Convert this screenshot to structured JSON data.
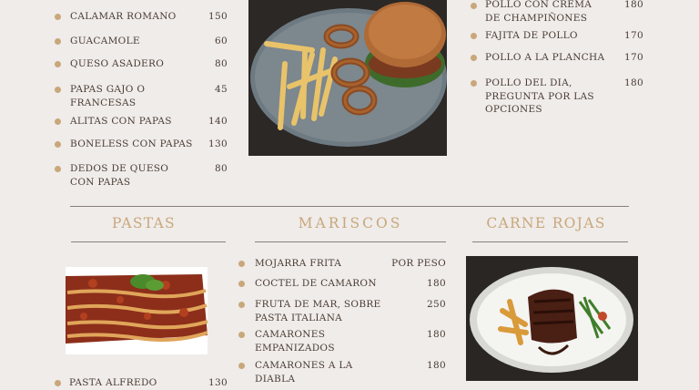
{
  "sections": {
    "pastas": "PASTAS",
    "mariscos": "MARISCOS",
    "carnes": "CARNE ROJAS"
  },
  "left_items": [
    {
      "name": "CALAMAR ROMANO",
      "price": "150"
    },
    {
      "name": "GUACAMOLE",
      "price": "60"
    },
    {
      "name": "QUESO ASADERO",
      "price": "80"
    },
    {
      "name": "PAPAS GAJO O FRANCESAS",
      "price": "45"
    },
    {
      "name": "ALITAS CON PAPAS",
      "price": "140"
    },
    {
      "name": "BONELESS CON PAPAS",
      "price": "130"
    },
    {
      "name": "DEDOS DE QUESO CON PAPAS",
      "price": "80"
    }
  ],
  "right_items": [
    {
      "name": "POLLO CON CREMA DE CHAMPIÑONES",
      "price": "180"
    },
    {
      "name": "FAJITA DE POLLO",
      "price": "170"
    },
    {
      "name": "POLLO A LA PLANCHA",
      "price": "170"
    },
    {
      "name": "POLLO DEL DIA, PREGUNTA POR LAS OPCIONES",
      "price": "180"
    }
  ],
  "mariscos_items": [
    {
      "name": "MOJARRA FRITA",
      "price": "POR PESO"
    },
    {
      "name": "COCTEL DE CAMARON",
      "price": "180"
    },
    {
      "name": "FRUTA DE MAR, SOBRE PASTA ITALIANA",
      "price": "250"
    },
    {
      "name": "CAMARONES EMPANIZADOS",
      "price": "180"
    },
    {
      "name": "CAMARONES A LA DIABLA",
      "price": "180"
    }
  ],
  "pastas_items": [
    {
      "name": "PASTA ALFREDO",
      "price": "130"
    }
  ],
  "photos": {
    "burger": "burger-and-fries-photo",
    "lasagna": "lasagna-photo",
    "steak": "steak-plate-photo"
  }
}
